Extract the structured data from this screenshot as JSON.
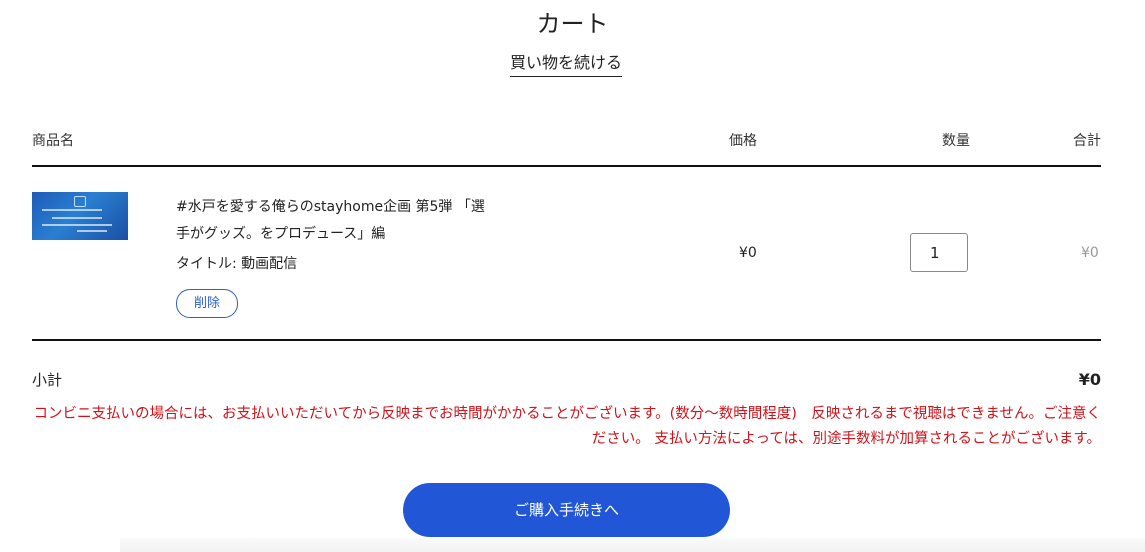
{
  "header": {
    "title": "カート",
    "continue_shopping": "買い物を続ける"
  },
  "table": {
    "columns": {
      "product": "商品名",
      "price": "価格",
      "quantity": "数量",
      "total": "合計"
    },
    "items": [
      {
        "name": "#水戸を愛する俺らのstayhome企画 第5弾 「選手がグッズ。をプロデュース」編",
        "option": "タイトル: 動画配信",
        "remove_label": "削除",
        "price": "¥0",
        "quantity": "1",
        "total": "¥0"
      }
    ]
  },
  "summary": {
    "subtotal_label": "小計",
    "subtotal_value": "¥0",
    "notice": "コンビニ支払いの場合には、お支払いいただいてから反映までお時間がかかることがございます。(数分〜数時間程度)　反映されるまで視聴はできません。ご注意ください。 支払い方法によっては、別途手数料が加算されることがございます。"
  },
  "checkout": {
    "button_label": "ご購入手続きへ"
  },
  "colors": {
    "accent": "#2156d6",
    "notice": "#d0121a",
    "rule": "#111111"
  }
}
